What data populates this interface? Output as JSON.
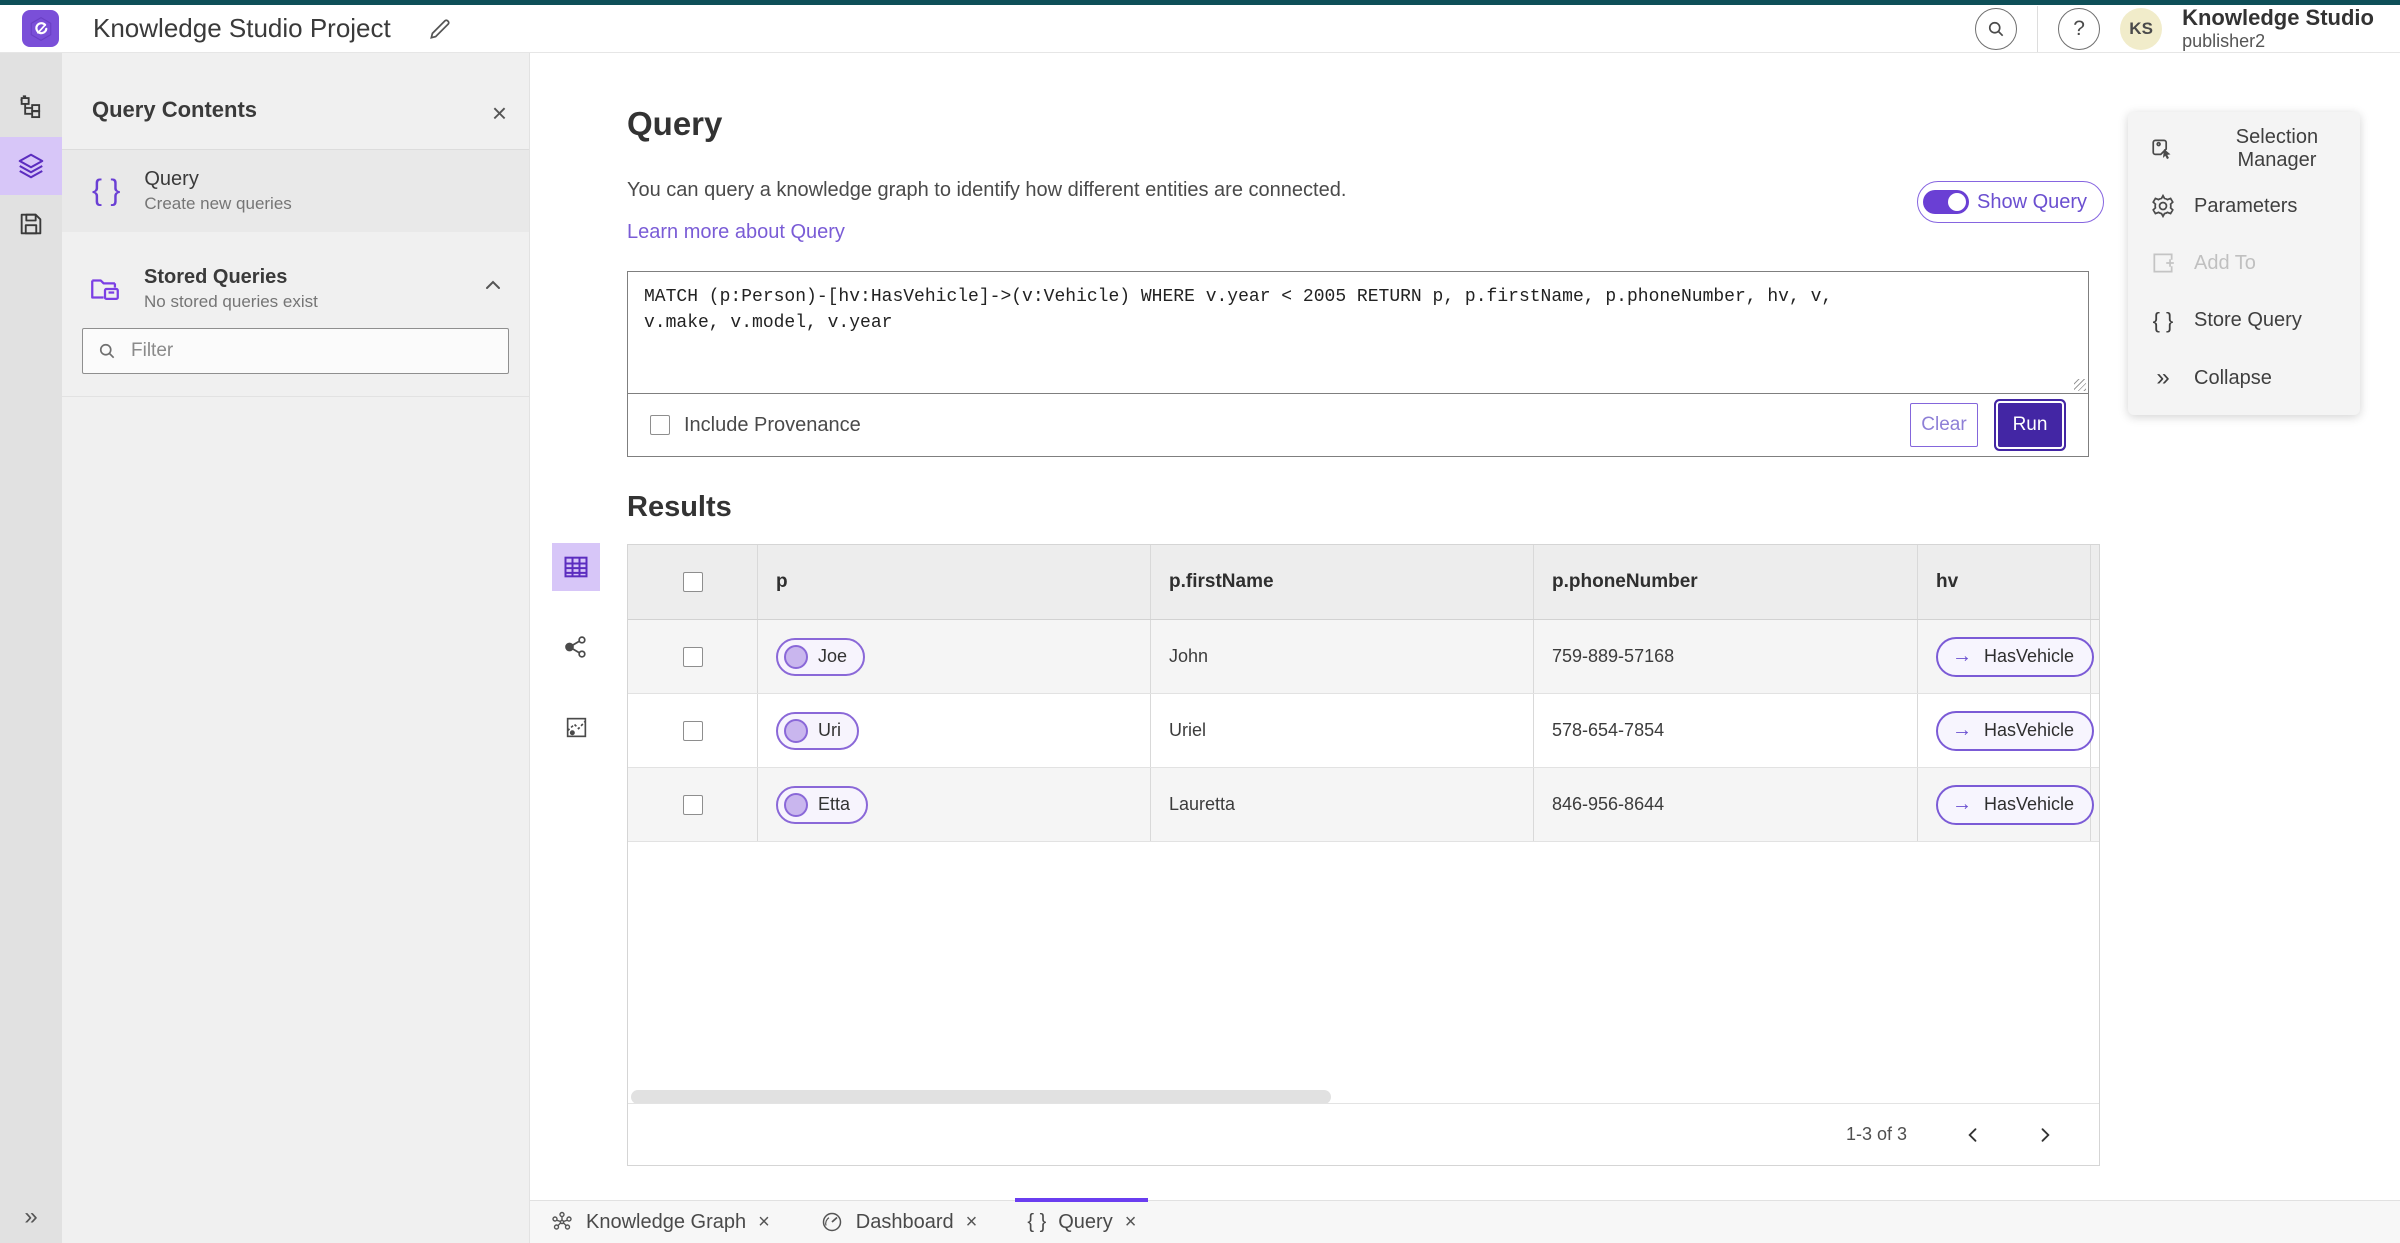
{
  "colors": {
    "brand_teal": "#0e4f58",
    "accent_purple": "#6a3fd4",
    "deep_purple": "#4326a4",
    "active_tab_purple": "#6a3df0",
    "active_icon_bg": "#d7c6f8",
    "avatar_bg": "#f1ecca"
  },
  "icons": {
    "close": "×",
    "braces": "{ }",
    "help": "?",
    "arrow_right": "→",
    "collapse": "»",
    "expand": "»"
  },
  "header": {
    "title": "Knowledge Studio Project",
    "avatar_initials": "KS",
    "product_name": "Knowledge Studio",
    "user_name": "publisher2"
  },
  "left_panel": {
    "title": "Query Contents",
    "query_item": {
      "title": "Query",
      "subtitle": "Create new queries"
    },
    "stored_queries": {
      "title": "Stored Queries",
      "subtitle": "No stored queries exist"
    },
    "filter_placeholder": "Filter"
  },
  "query_section": {
    "title": "Query",
    "description": "You can query a knowledge graph to identify how different entities are connected.",
    "learn_more": "Learn more about Query",
    "show_query_label": "Show Query",
    "query_text": "MATCH (p:Person)-[hv:HasVehicle]->(v:Vehicle) WHERE v.year < 2005 RETURN p, p.firstName, p.phoneNumber, hv, v,\nv.make, v.model, v.year",
    "include_provenance_label": "Include Provenance",
    "clear_label": "Clear",
    "run_label": "Run"
  },
  "results": {
    "title": "Results",
    "columns": [
      "p",
      "p.firstName",
      "p.phoneNumber",
      "hv"
    ],
    "rows": [
      {
        "p": "Joe",
        "firstName": "John",
        "phoneNumber": "759-889-57168",
        "hv": "HasVehicle"
      },
      {
        "p": "Uri",
        "firstName": "Uriel",
        "phoneNumber": "578-654-7854",
        "hv": "HasVehicle"
      },
      {
        "p": "Etta",
        "firstName": "Lauretta",
        "phoneNumber": "846-956-8644",
        "hv": "HasVehicle"
      }
    ],
    "pagination": "1-3 of 3"
  },
  "right_panel": {
    "items": [
      {
        "label": "Selection Manager"
      },
      {
        "label": "Parameters"
      },
      {
        "label": "Add To"
      },
      {
        "label": "Store Query"
      },
      {
        "label": "Collapse"
      }
    ]
  },
  "bottom_tabs": [
    {
      "label": "Knowledge Graph"
    },
    {
      "label": "Dashboard"
    },
    {
      "label": "Query"
    }
  ]
}
